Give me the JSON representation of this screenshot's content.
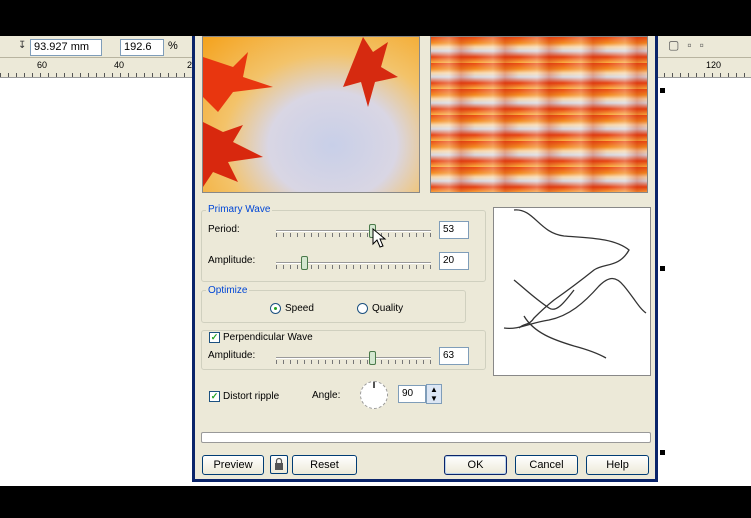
{
  "toolbar": {
    "width_value": "93.927 mm",
    "scale_value": "192.6",
    "scale_unit": "%"
  },
  "ruler": {
    "labels": [
      "60",
      "40",
      "2",
      "120"
    ]
  },
  "dialog": {
    "primary_wave": {
      "title": "Primary Wave",
      "period_label": "Period:",
      "period_value": "53",
      "period_fraction": 0.62,
      "amplitude_label": "Amplitude:",
      "amplitude_value": "20",
      "amplitude_fraction": 0.18
    },
    "optimize": {
      "title": "Optimize",
      "speed_label": "Speed",
      "quality_label": "Quality",
      "selected": "Speed"
    },
    "perpendicular_wave": {
      "label": "Perpendicular Wave",
      "checked": true,
      "amplitude_label": "Amplitude:",
      "amplitude_value": "63",
      "amplitude_fraction": 0.62
    },
    "distort": {
      "label": "Distort ripple",
      "checked": true,
      "angle_label": "Angle:",
      "angle_value": "90"
    },
    "buttons": {
      "preview": "Preview",
      "reset": "Reset",
      "ok": "OK",
      "cancel": "Cancel",
      "help": "Help"
    }
  },
  "colors": {
    "dialog_bg": "#ece9d8",
    "group_title": "#0046d5",
    "accent_border": "#0a246a"
  }
}
